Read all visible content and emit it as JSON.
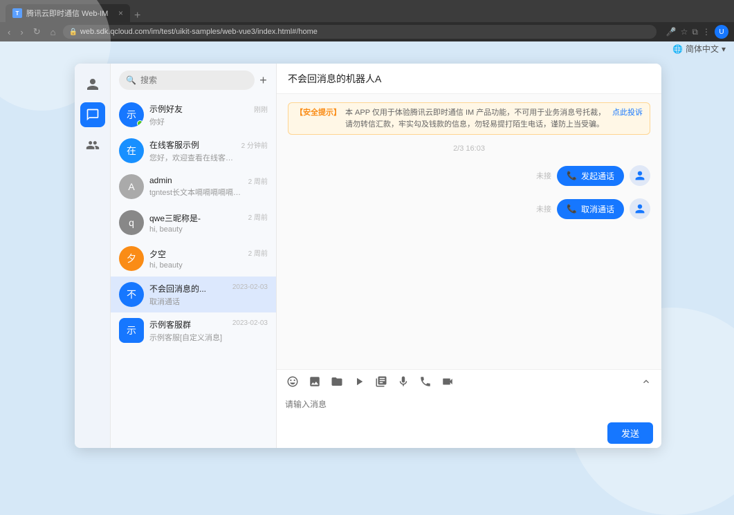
{
  "browser": {
    "tab_title": "腾讯云即时通信 Web-IM",
    "url": "web.sdk.qcloud.com/im/test/uikit-samples/web-vue3/index.html#/home",
    "new_tab_icon": "+",
    "close_icon": "×",
    "nav": {
      "back": "‹",
      "forward": "›",
      "refresh": "↻",
      "home": "⌂"
    }
  },
  "topbar": {
    "language": "简体中文",
    "dropdown_icon": "▾"
  },
  "sidebar": {
    "icons": [
      {
        "id": "contacts",
        "glyph": "👤",
        "active": false
      },
      {
        "id": "chat",
        "glyph": "💬",
        "active": true
      },
      {
        "id": "group",
        "glyph": "👥",
        "active": false
      }
    ]
  },
  "search": {
    "placeholder": "搜索",
    "add_icon": "+"
  },
  "conversations": [
    {
      "id": "shili-haoyou",
      "name": "示例好友",
      "last_msg": "你好",
      "time": "刚刚",
      "avatar_color": "#1677ff",
      "avatar_text": "示",
      "active": false,
      "online": true
    },
    {
      "id": "zaixian-kefu",
      "name": "在线客服示例",
      "last_msg": "您好，欢迎查看在线客服示例。",
      "time": "2 分钟前",
      "avatar_color": "#1677ff",
      "avatar_text": "在",
      "active": false
    },
    {
      "id": "admin",
      "name": "admin",
      "last_msg": "tgntest长文本嗝嗝嗝嗝嗝嗝嗝嗝嗝嗝嗝...",
      "time": "2 周前",
      "avatar_color": "#aaa",
      "avatar_text": "A",
      "active": false
    },
    {
      "id": "qwe-sancheng",
      "name": "qwe三昵称是-",
      "last_msg": "hi, beauty",
      "time": "2 周前",
      "avatar_color": "#888",
      "avatar_text": "q",
      "active": false
    },
    {
      "id": "xiakong",
      "name": "夕空",
      "last_msg": "hi, beauty",
      "time": "2 周前",
      "avatar_color": "#fa8c16",
      "avatar_text": "夕",
      "active": false
    },
    {
      "id": "buhui-xiaox",
      "name": "不会回消息的...",
      "last_msg": "取消通话",
      "time": "2023-02-03",
      "avatar_color": "#1677ff",
      "avatar_text": "不",
      "active": true
    },
    {
      "id": "shili-kefu-qun",
      "name": "示例客服群",
      "last_msg": "示例客服[自定义消息]",
      "time": "2023-02-03",
      "avatar_color": "#1677ff",
      "avatar_text": "示",
      "is_group": true,
      "active": false
    }
  ],
  "chat": {
    "header_title": "不会回消息的机器人A",
    "security_notice": {
      "label": "【安全提示】",
      "text": "本 APP 仅用于体验腾讯云即时通信 IM 产品功能，不可用于业务消息号托裁，请勿转信汇款，牢实勾及钱款的信息，勿轻易提打陌生电话，谨防上当受骗。",
      "link_text": "点此投诉"
    },
    "date_divider": "2/3 16:03",
    "messages": [
      {
        "id": "call1",
        "type": "outgoing_call",
        "label": "未接",
        "btn_text": "发起通话",
        "icon": "📞"
      },
      {
        "id": "call2",
        "type": "cancel_call",
        "label": "未接",
        "btn_text": "取消通话",
        "icon": "📞"
      }
    ],
    "input_placeholder": "请输入消息",
    "send_btn": "发送",
    "toolbar_items": [
      {
        "id": "emoji",
        "glyph": "☺",
        "title": "emoji"
      },
      {
        "id": "image",
        "glyph": "🖼",
        "title": "image"
      },
      {
        "id": "folder",
        "glyph": "📁",
        "title": "file"
      },
      {
        "id": "video",
        "glyph": "▶",
        "title": "video"
      },
      {
        "id": "screenshot",
        "glyph": "⊞",
        "title": "screenshot"
      },
      {
        "id": "microphone2",
        "glyph": "⊟",
        "title": "microphone"
      },
      {
        "id": "phone",
        "glyph": "☎",
        "title": "phone"
      },
      {
        "id": "videocall",
        "glyph": "📹",
        "title": "video-call"
      }
    ],
    "expand_icon": "⊕"
  }
}
